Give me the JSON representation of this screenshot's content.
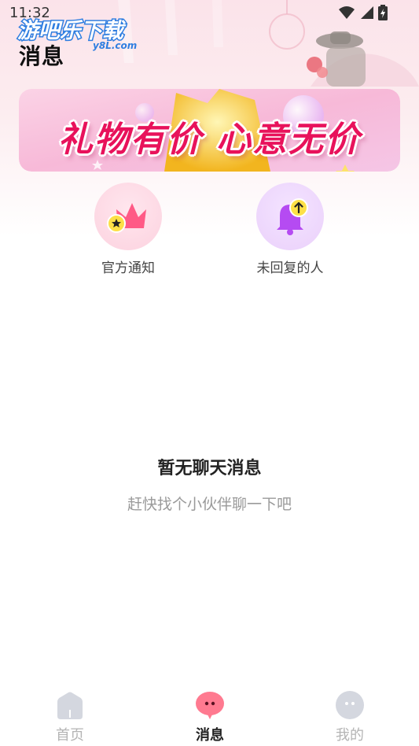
{
  "status_bar": {
    "time": "11:32"
  },
  "watermark": {
    "title": "游吧乐下载",
    "subtitle": "y8L.com"
  },
  "page_title": "消息",
  "banner": {
    "text": "礼物有价 心意无价"
  },
  "quick_actions": [
    {
      "label": "官方通知",
      "icon": "crown-icon"
    },
    {
      "label": "未回复的人",
      "icon": "bell-icon"
    }
  ],
  "empty_state": {
    "title": "暂无聊天消息",
    "subtitle": "赶快找个小伙伴聊一下吧"
  },
  "tabbar": {
    "items": [
      {
        "label": "首页",
        "icon": "home-icon",
        "active": false
      },
      {
        "label": "消息",
        "icon": "chat-bubble-icon",
        "active": true
      },
      {
        "label": "我的",
        "icon": "profile-face-icon",
        "active": false
      }
    ]
  },
  "colors": {
    "accent": "#e8125b",
    "header_pink": "#fbe3ea",
    "muted_text": "#9a9a9a",
    "tab_active_icon": "#ff6f86",
    "tab_inactive_icon": "#d4d7df"
  }
}
